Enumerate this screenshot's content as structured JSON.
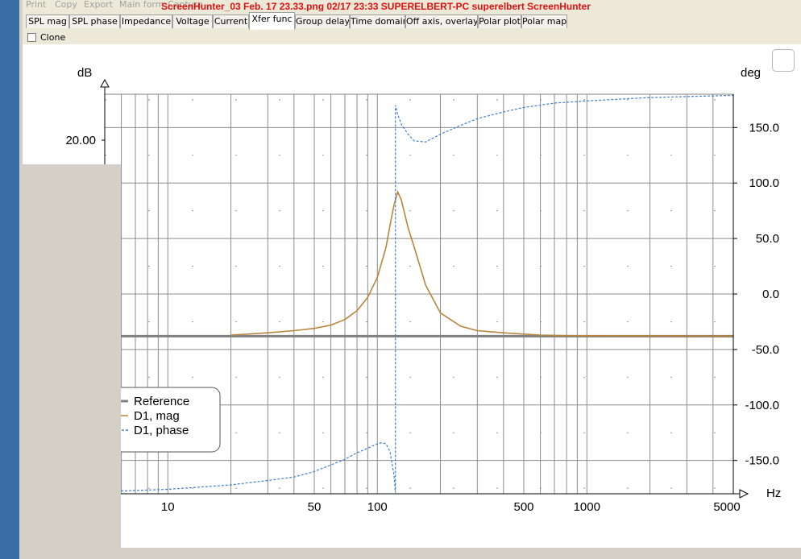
{
  "menu": {
    "print": "Print",
    "copy": "Copy",
    "export": "Export",
    "main_form": "Main form",
    "extra": "Capture"
  },
  "watermark": "ScreenHunter_03 Feb. 17 23.33.png   02/17   23:33   SUPERELBERT-PC   superelbert   ScreenHunter",
  "tabs": [
    {
      "label": "SPL mag"
    },
    {
      "label": "SPL phase"
    },
    {
      "label": "Impedance"
    },
    {
      "label": "Voltage"
    },
    {
      "label": "Current"
    },
    {
      "label": "Xfer func",
      "active": true
    },
    {
      "label": "Group delay"
    },
    {
      "label": "Time domain"
    },
    {
      "label": "Off axis, overlay"
    },
    {
      "label": "Polar plot"
    },
    {
      "label": "Polar map"
    }
  ],
  "clone_label": "Clone",
  "chart_data": {
    "type": "line",
    "left_unit": "dB",
    "right_unit": "deg",
    "x_unit": "Hz",
    "x_scale": "log",
    "xlim": [
      5,
      5000
    ],
    "x_tick_labels": [
      "z",
      "10",
      "50",
      "100",
      "500",
      "1000",
      "5000"
    ],
    "left_tick_labels": [
      "20.00"
    ],
    "right_ylim": [
      -180,
      180
    ],
    "right_ticks": [
      150,
      100,
      50,
      0,
      -50,
      -100,
      -150
    ],
    "right_tick_labels": [
      "150.0",
      "100.0",
      "50.0",
      "0.0",
      "-50.0",
      "-100.0",
      "-150.0"
    ],
    "grid": true,
    "legend_position": "bottom-left",
    "series": [
      {
        "name": "Reference",
        "color": "#808080",
        "style": "solid",
        "axis": "phase",
        "x": [
          5,
          5000
        ],
        "y": [
          -38,
          -38
        ]
      },
      {
        "name": "D1, mag",
        "color": "#b8853a",
        "style": "solid",
        "axis": "phase",
        "x": [
          20,
          30,
          40,
          50,
          60,
          70,
          80,
          90,
          100,
          110,
          115,
          120,
          125,
          130,
          140,
          150,
          170,
          200,
          250,
          300,
          400,
          600,
          800,
          5000
        ],
        "y": [
          -37,
          -35,
          -33,
          -31,
          -28,
          -23,
          -15,
          -3,
          15,
          42,
          62,
          80,
          92,
          85,
          60,
          42,
          8,
          -17,
          -29,
          -33,
          -35,
          -37,
          -37.5,
          -38
        ]
      },
      {
        "name": "D1, phase",
        "color": "#3d7fc9",
        "style": "dotted",
        "axis": "phase",
        "x": [
          5,
          10,
          20,
          30,
          40,
          50,
          60,
          70,
          80,
          90,
          100,
          105,
          110,
          115,
          120,
          122,
          122,
          125,
          130,
          140,
          150,
          170,
          200,
          250,
          300,
          400,
          500,
          700,
          1000,
          2000,
          5000
        ],
        "y": [
          -178,
          -176,
          -172,
          -168,
          -165,
          -160,
          -154,
          -149,
          -143,
          -139,
          -135,
          -134,
          -135,
          -142,
          -163,
          -179,
          170,
          162,
          153,
          144,
          138,
          137,
          144,
          152,
          158,
          164,
          168,
          172,
          174,
          177,
          179
        ]
      }
    ]
  }
}
